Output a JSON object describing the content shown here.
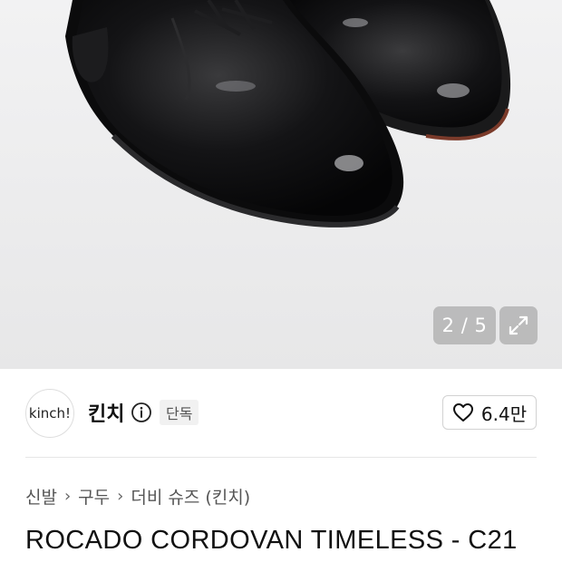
{
  "gallery": {
    "image_alt": "black leather derby shoes",
    "counter": "2 / 5",
    "expand_icon": "expand-arrows-icon"
  },
  "brand": {
    "logo_text": "kinch!",
    "name": "킨치",
    "info_icon": "info-circle-icon",
    "badge": "단독"
  },
  "like": {
    "icon": "heart-outline-icon",
    "count": "6.4만"
  },
  "breadcrumb": {
    "items": [
      "신발",
      "구두",
      "더비 슈즈 (킨치)"
    ],
    "separator_icon": "chevron-right-icon"
  },
  "product": {
    "title": "ROCADO CORDOVAN TIMELESS - C21"
  }
}
